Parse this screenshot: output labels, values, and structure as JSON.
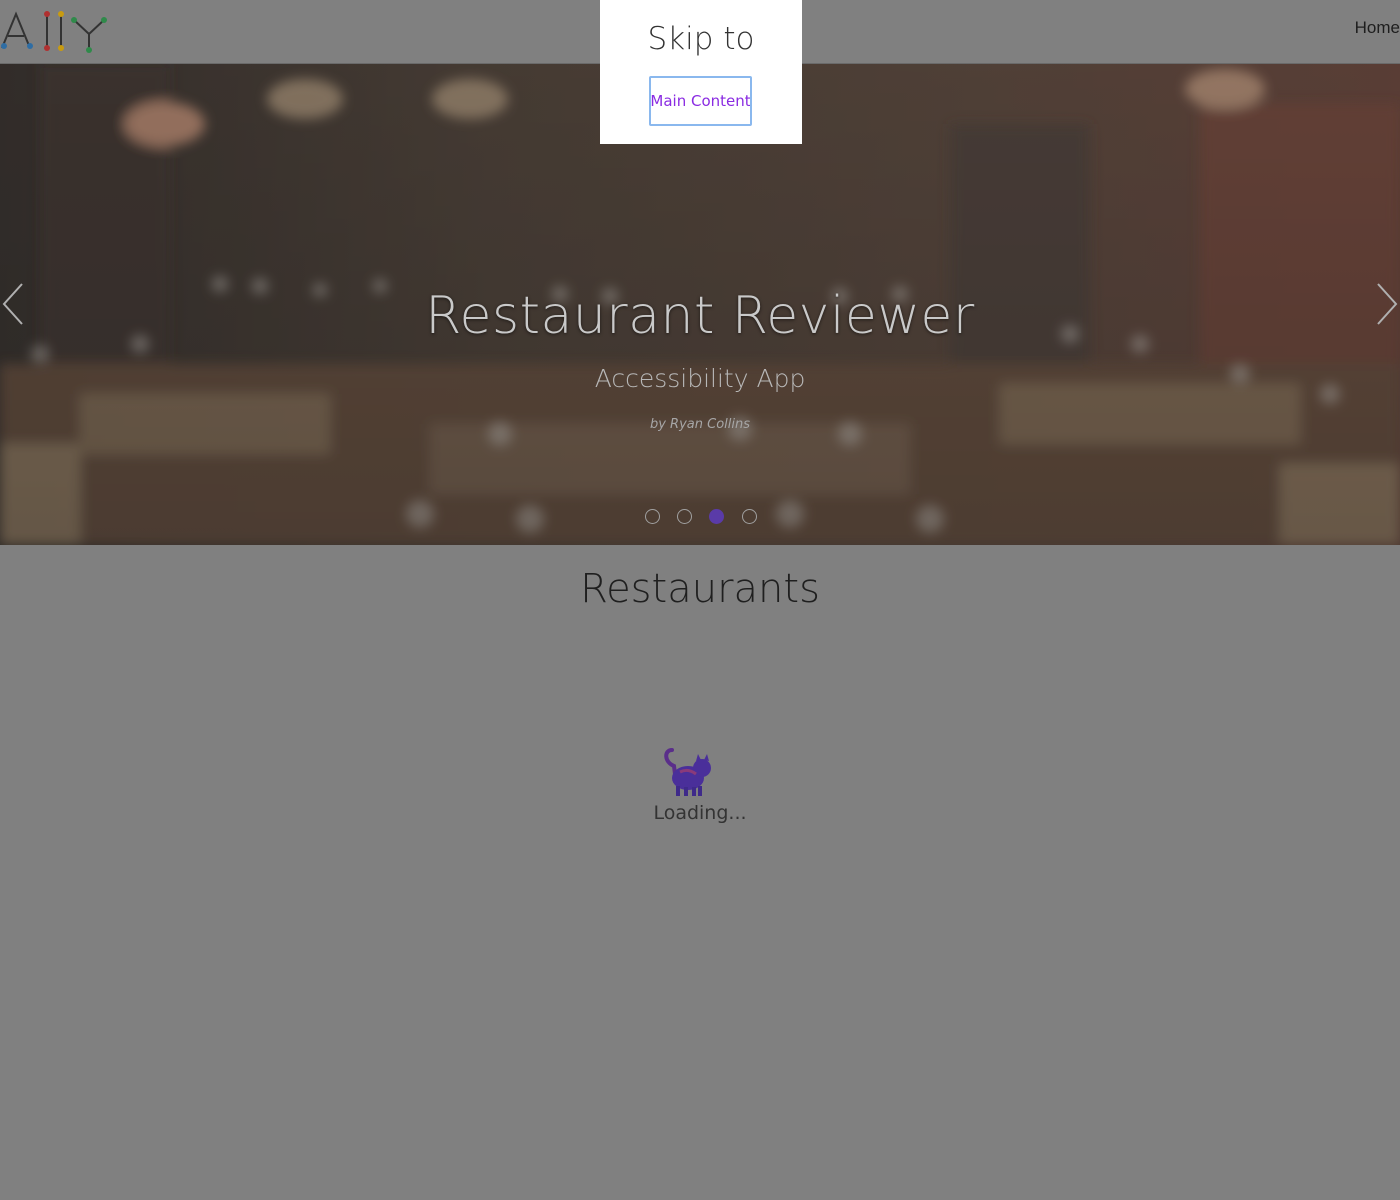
{
  "header": {
    "logo_text": "A11Y",
    "nav_home": "Home"
  },
  "hero": {
    "title": "Restaurant Reviewer",
    "subtitle": "Accessibility App",
    "byline": "by Ryan Collins",
    "slides_count": 4,
    "active_slide_index": 2
  },
  "main": {
    "section_title": "Restaurants",
    "loading_text": "Loading..."
  },
  "skip_dialog": {
    "title": "Skip to",
    "link_label": "Main Content",
    "link_color": "#8a2be2"
  },
  "colors": {
    "overlay": "#808080",
    "active_dot": "#5a3ba8"
  }
}
